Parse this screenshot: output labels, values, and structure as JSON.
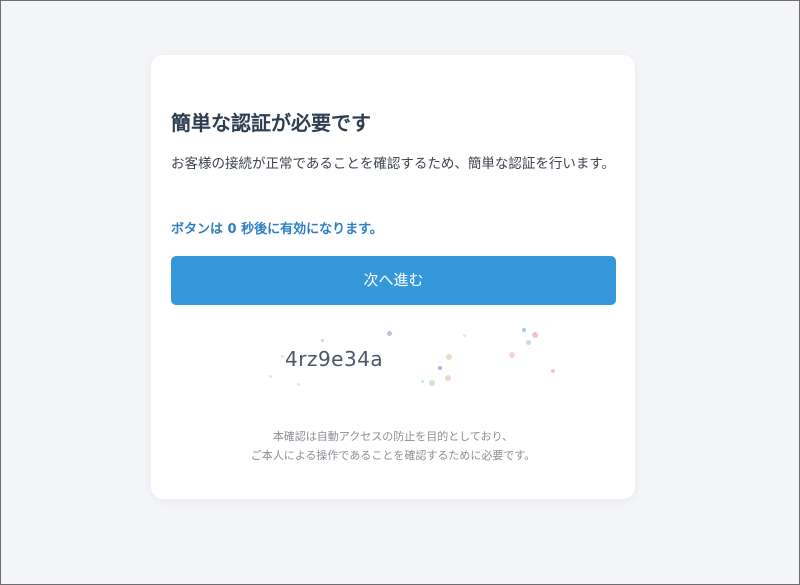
{
  "verification": {
    "title": "簡単な認証が必要です",
    "description": "お客様の接続が正常であることを確認するため、簡単な認証を行います。",
    "countdown_text": "ボタンは 0 秒後に有効になります。",
    "button_label": "次へ進む",
    "captcha_code": "4rz9e34a",
    "note_line1": "本確認は自動アクセスの防止を目的としており、",
    "note_line2": "ご本人による操作であることを確認するために必要です。"
  },
  "colors": {
    "button": "#3498db",
    "countdown": "#2c7fc4",
    "title": "#2d3e50",
    "background": "#f4f5f8"
  }
}
